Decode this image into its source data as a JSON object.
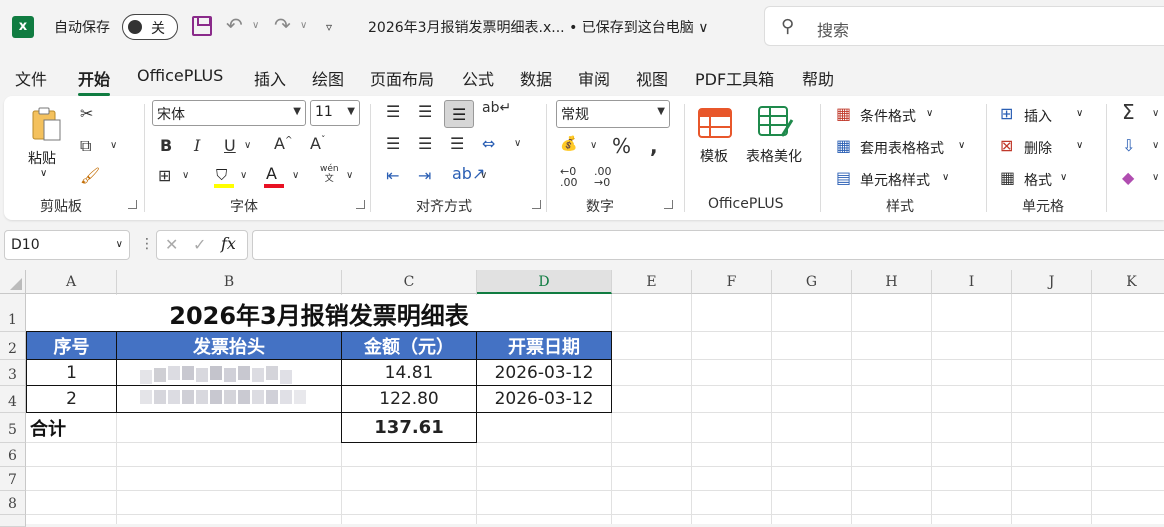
{
  "titlebar": {
    "autosave_label": "自动保存",
    "autosave_state": "关",
    "document_title": "2026年3月报销发票明细表.x... • 已保存到这台电脑 ∨",
    "search_placeholder": "搜索"
  },
  "menu": {
    "tabs": [
      "文件",
      "开始",
      "OfficePLUS",
      "插入",
      "绘图",
      "页面布局",
      "公式",
      "数据",
      "审阅",
      "视图",
      "PDF工具箱",
      "帮助"
    ],
    "active": "开始"
  },
  "ribbon": {
    "clipboard": {
      "paste": "粘贴",
      "label": "剪贴板"
    },
    "font": {
      "name": "宋体",
      "size": "11",
      "label": "字体",
      "font_color": "#e81123",
      "highlight_color": "#ffff00"
    },
    "alignment": {
      "label": "对齐方式"
    },
    "number": {
      "format": "常规",
      "label": "数字"
    },
    "officeplus": {
      "template": "模板",
      "beautify": "表格美化",
      "label": "OfficePLUS"
    },
    "styles": {
      "conditional": "条件格式",
      "table_format": "套用表格格式",
      "cell_styles": "单元格样式",
      "label": "样式"
    },
    "cells": {
      "insert": "插入",
      "delete": "删除",
      "format": "格式",
      "label": "单元格"
    }
  },
  "formula_bar": {
    "name_box": "D10",
    "content": ""
  },
  "sheet": {
    "columns": [
      "A",
      "B",
      "C",
      "D",
      "E",
      "F",
      "G",
      "H",
      "I",
      "J",
      "K"
    ],
    "selected_column": "D",
    "rows": [
      "1",
      "2",
      "3",
      "4",
      "5",
      "6",
      "7",
      "8"
    ],
    "title": "2026年3月报销发票明细表",
    "headers": [
      "序号",
      "发票抬头",
      "金额（元）",
      "开票日期"
    ],
    "data_rows": [
      {
        "no": "1",
        "payer": "",
        "amount": "14.81",
        "date": "2026-03-12"
      },
      {
        "no": "2",
        "payer": "",
        "amount": "122.80",
        "date": "2026-03-12"
      }
    ],
    "total_label": "合计",
    "total_value": "137.61",
    "header_color": "#4472c4"
  }
}
